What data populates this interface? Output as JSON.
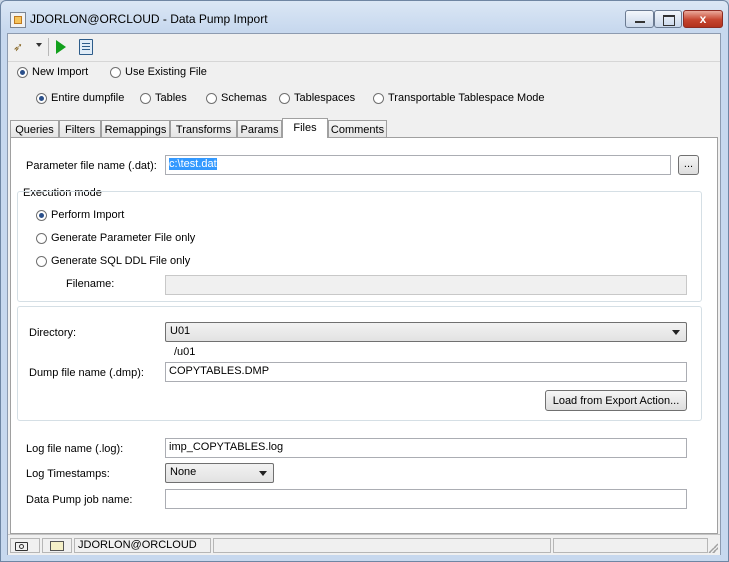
{
  "window": {
    "title": "JDORLON@ORCLOUD - Data Pump Import",
    "close_glyph": "x",
    "icons": [
      "app-icon",
      "minimize-icon",
      "maximize-icon",
      "close-icon"
    ]
  },
  "toolbar": {
    "icons": [
      "wizard-icon",
      "dropdown-arrow-icon",
      "run-icon",
      "clipboard-icon"
    ]
  },
  "import_mode": {
    "options": [
      {
        "label": "New Import",
        "selected": true
      },
      {
        "label": "Use Existing File",
        "selected": false
      }
    ]
  },
  "scope": {
    "options": [
      {
        "label": "Entire dumpfile",
        "selected": true
      },
      {
        "label": "Tables",
        "selected": false
      },
      {
        "label": "Schemas",
        "selected": false
      },
      {
        "label": "Tablespaces",
        "selected": false
      },
      {
        "label": "Transportable Tablespace Mode",
        "selected": false
      }
    ]
  },
  "tabs": [
    {
      "label": "Queries",
      "active": false
    },
    {
      "label": "Filters",
      "active": false
    },
    {
      "label": "Remappings",
      "active": false
    },
    {
      "label": "Transforms",
      "active": false
    },
    {
      "label": "Params",
      "active": false
    },
    {
      "label": "Files",
      "active": true
    },
    {
      "label": "Comments",
      "active": false
    }
  ],
  "files": {
    "param_file_label": "Parameter file name (.dat):",
    "param_file_value": "c:\\test.dat",
    "browse_label": "...",
    "execution_mode_label": "Execution mode",
    "execution_options": [
      {
        "label": "Perform Import",
        "selected": true
      },
      {
        "label": "Generate Parameter File only",
        "selected": false
      },
      {
        "label": "Generate SQL DDL File only",
        "selected": false
      }
    ],
    "filename_label": "Filename:",
    "filename_value": "",
    "directory_label": "Directory:",
    "directory_value": "U01",
    "directory_path": "/u01",
    "dump_file_label": "Dump file name (.dmp):",
    "dump_file_value": "COPYTABLES.DMP",
    "load_button": "Load from Export Action...",
    "log_file_label": "Log file name (.log):",
    "log_file_value": "imp_COPYTABLES.log",
    "log_timestamps_label": "Log Timestamps:",
    "log_timestamps_value": "None",
    "job_name_label": "Data Pump job name:",
    "job_name_value": ""
  },
  "status": {
    "connection": "JDORLON@ORCLOUD",
    "icons": [
      "camera-icon",
      "connection-icon",
      "resize-grip-icon"
    ]
  }
}
